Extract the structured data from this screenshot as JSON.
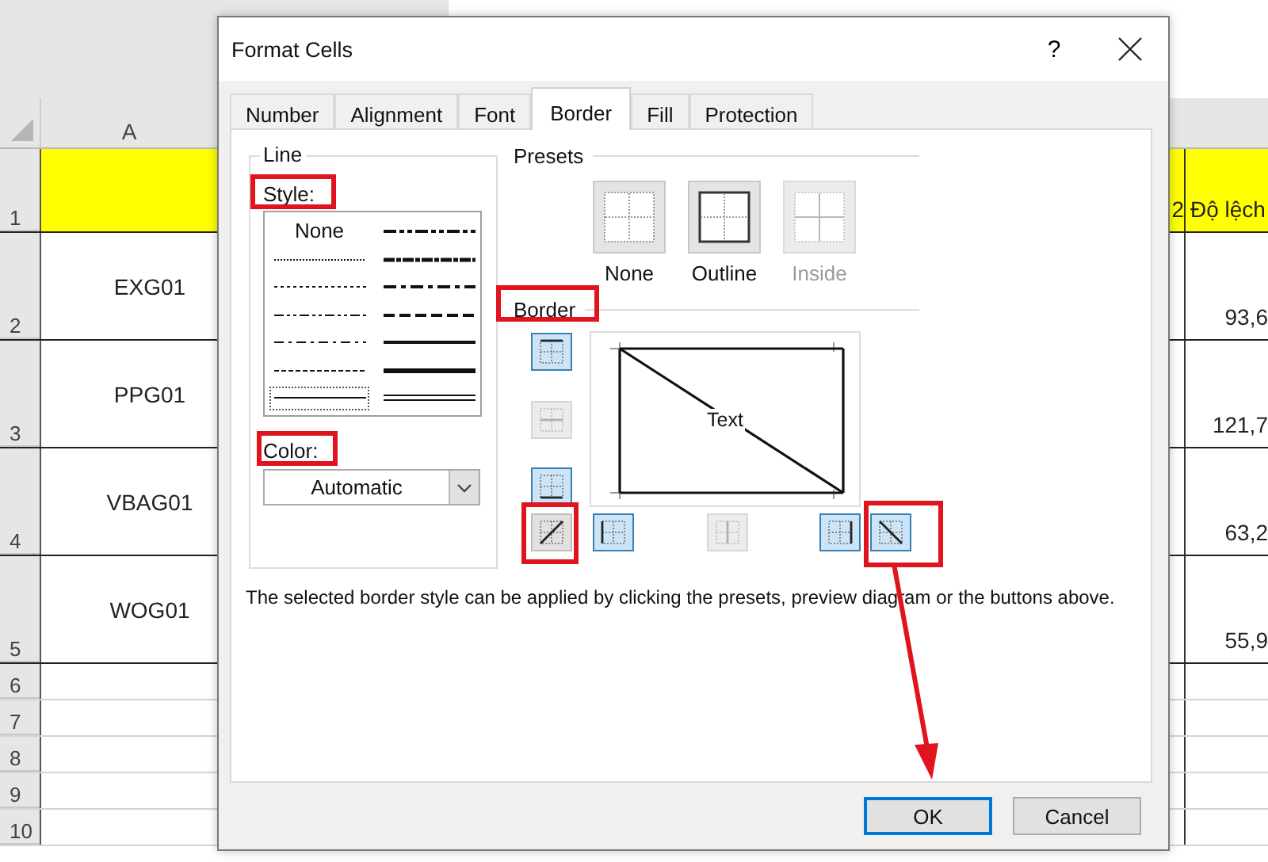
{
  "sheet": {
    "column_headers": [
      {
        "label": "A"
      }
    ],
    "rows": [
      {
        "number": "1",
        "column_a": "",
        "column_b": "2",
        "column_c": "Độ lệch",
        "highlighted": true
      },
      {
        "number": "2",
        "column_a": "EXG01",
        "column_c": "93,6",
        "highlighted": false
      },
      {
        "number": "3",
        "column_a": "PPG01",
        "column_c": "121,7",
        "highlighted": false
      },
      {
        "number": "4",
        "column_a": "VBAG01",
        "column_c": "63,2",
        "highlighted": false
      },
      {
        "number": "5",
        "column_a": "WOG01",
        "column_c": "55,9",
        "highlighted": false
      },
      {
        "number": "6",
        "highlighted": false
      },
      {
        "number": "7",
        "highlighted": false
      },
      {
        "number": "8",
        "highlighted": false
      },
      {
        "number": "9",
        "highlighted": false
      },
      {
        "number": "10",
        "highlighted": false
      }
    ]
  },
  "dialog": {
    "title": "Format Cells",
    "help": "?",
    "tabs": [
      {
        "label": "Number",
        "selected": false
      },
      {
        "label": "Alignment",
        "selected": false
      },
      {
        "label": "Font",
        "selected": false
      },
      {
        "label": "Border",
        "selected": true
      },
      {
        "label": "Fill",
        "selected": false
      },
      {
        "label": "Protection",
        "selected": false
      }
    ],
    "line": {
      "legend": "Line",
      "style_label": "Style:",
      "color_label": "Color:",
      "color_value": "Automatic",
      "styles": [
        {
          "kind": "none",
          "label": "None",
          "selected": false
        },
        {
          "kind": "hair",
          "selected": false
        },
        {
          "kind": "dotted",
          "selected": false
        },
        {
          "kind": "dash_dot_dot",
          "selected": false
        },
        {
          "kind": "dash_dot",
          "selected": false
        },
        {
          "kind": "dashed",
          "selected": false
        },
        {
          "kind": "thin",
          "selected": true
        },
        {
          "kind": "medium_dash_dot_dot",
          "selected": false
        },
        {
          "kind": "slanted_dash_dot",
          "selected": false
        },
        {
          "kind": "medium_dash_dot",
          "selected": false
        },
        {
          "kind": "medium_dashed",
          "selected": false
        },
        {
          "kind": "medium",
          "selected": false
        },
        {
          "kind": "thick",
          "selected": false
        },
        {
          "kind": "double",
          "selected": false
        }
      ]
    },
    "presets": {
      "legend": "Presets",
      "items": [
        {
          "kind": "none",
          "label": "None",
          "disabled": false
        },
        {
          "kind": "outline",
          "label": "Outline",
          "disabled": false
        },
        {
          "kind": "inside",
          "label": "Inside",
          "disabled": true
        }
      ]
    },
    "border": {
      "legend": "Border",
      "preview_text": "Text",
      "buttons": [
        {
          "kind": "top",
          "pressed": true,
          "disabled": false
        },
        {
          "kind": "middle_horizontal",
          "pressed": false,
          "disabled": true
        },
        {
          "kind": "bottom",
          "pressed": true,
          "disabled": false
        },
        {
          "kind": "diagonal_up",
          "pressed": false,
          "disabled": false
        },
        {
          "kind": "left",
          "pressed": true,
          "disabled": false
        },
        {
          "kind": "middle_vertical",
          "pressed": false,
          "disabled": true
        },
        {
          "kind": "right",
          "pressed": true,
          "disabled": false
        },
        {
          "kind": "diagonal_down",
          "pressed": true,
          "disabled": false
        }
      ]
    },
    "description": "The selected border style can be applied by clicking the presets, preview diagram or the buttons above.",
    "buttons": [
      {
        "label": "OK",
        "default": true
      },
      {
        "label": "Cancel",
        "default": false
      }
    ]
  }
}
